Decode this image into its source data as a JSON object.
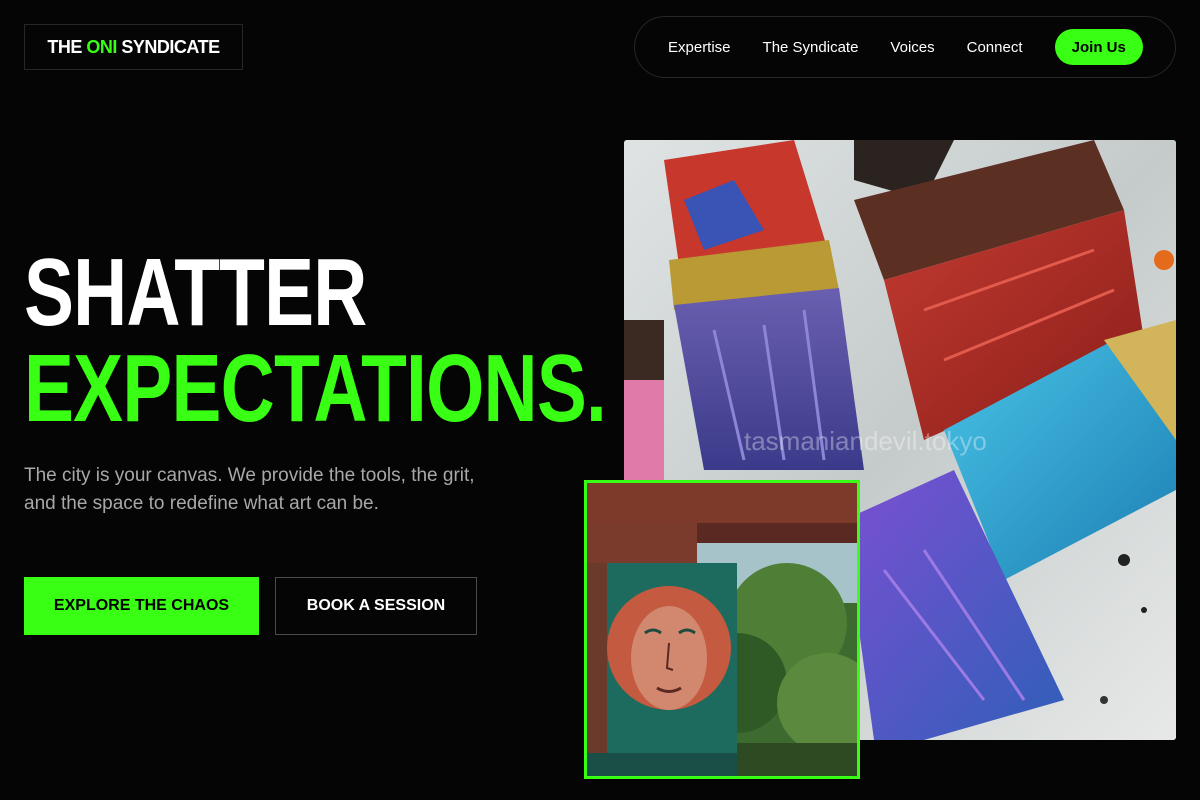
{
  "brand": {
    "logo_pre": "THE ",
    "logo_accent": "ONI",
    "logo_post": " SYNDICATE",
    "accent_color": "#39ff14"
  },
  "nav": {
    "items": [
      {
        "label": "Expertise"
      },
      {
        "label": "The Syndicate"
      },
      {
        "label": "Voices"
      },
      {
        "label": "Connect"
      }
    ],
    "cta_label": "Join Us"
  },
  "hero": {
    "title_line1": "SHATTER",
    "title_line2": "EXPECTATIONS.",
    "subtitle": "The city is your canvas. We provide the tools, the grit, and the space to redefine what art can be.",
    "primary_button": "EXPLORE THE CHAOS",
    "secondary_button": "BOOK A SESSION"
  },
  "images": {
    "main_watermark": "tasmaniandevil.tokyo"
  }
}
